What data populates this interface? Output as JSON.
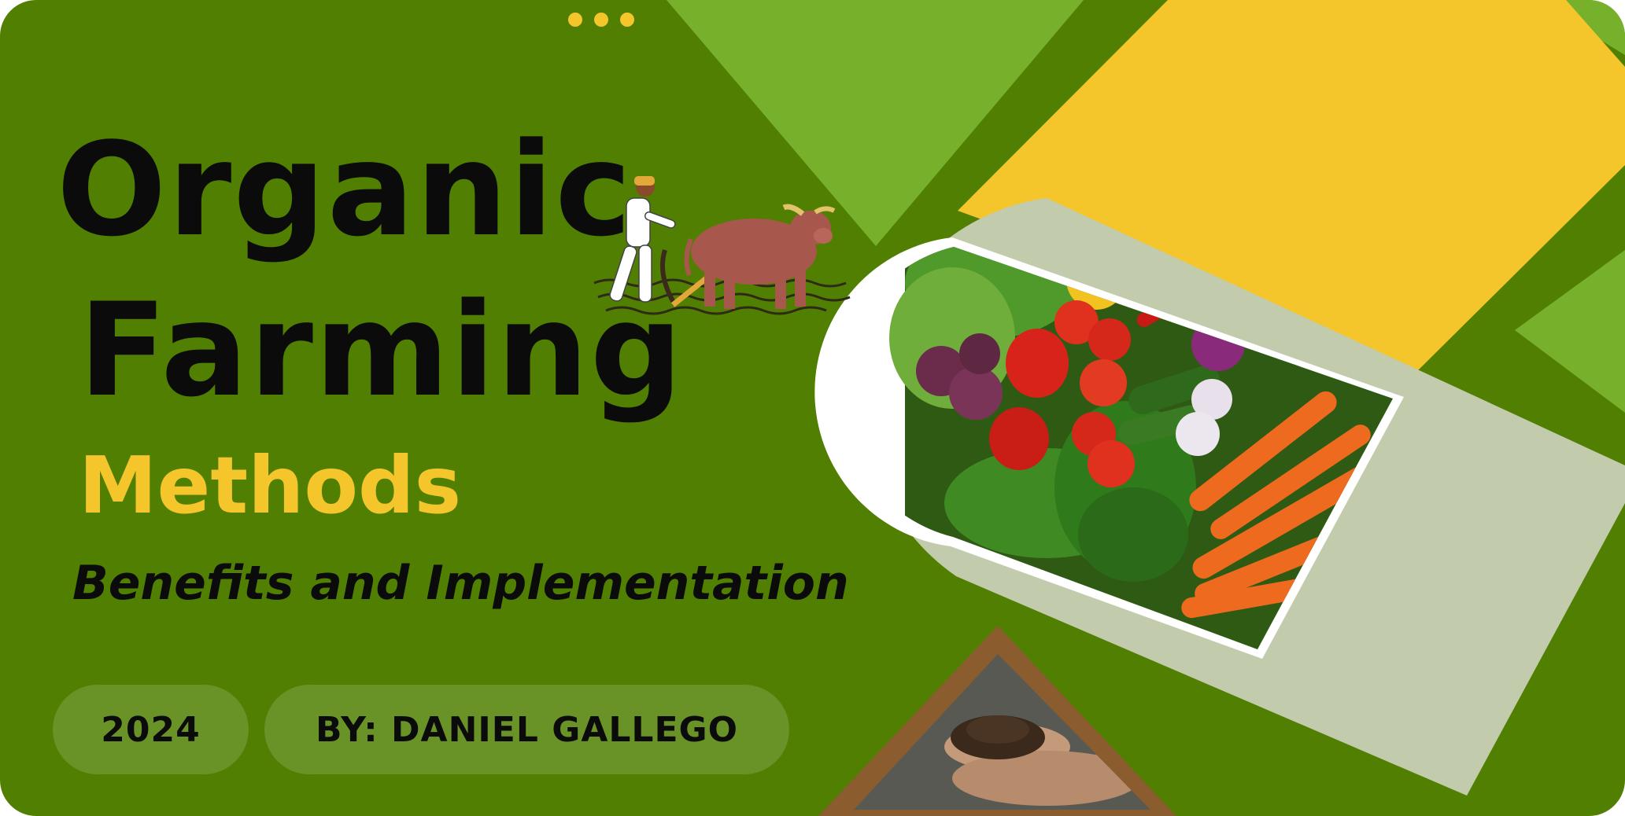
{
  "slide": {
    "title_line_1": "Organic",
    "title_line_2": "Farming",
    "subtitle": "Methods",
    "tagline": "Benefits and Implementation",
    "year": "2024",
    "author": "BY: DANIEL GALLEGO"
  },
  "images": {
    "farmer": "farmer-plowing-with-ox-illustration",
    "vegetables": "assorted-fresh-vegetables-photo",
    "soil": "hands-holding-soil-photo"
  },
  "colors": {
    "background": "#517f02",
    "light_green": "#77b12b",
    "yellow": "#f4c62b",
    "sage": "#c2cbac",
    "brown": "#8a5c2e",
    "text": "#0b0b0b"
  }
}
